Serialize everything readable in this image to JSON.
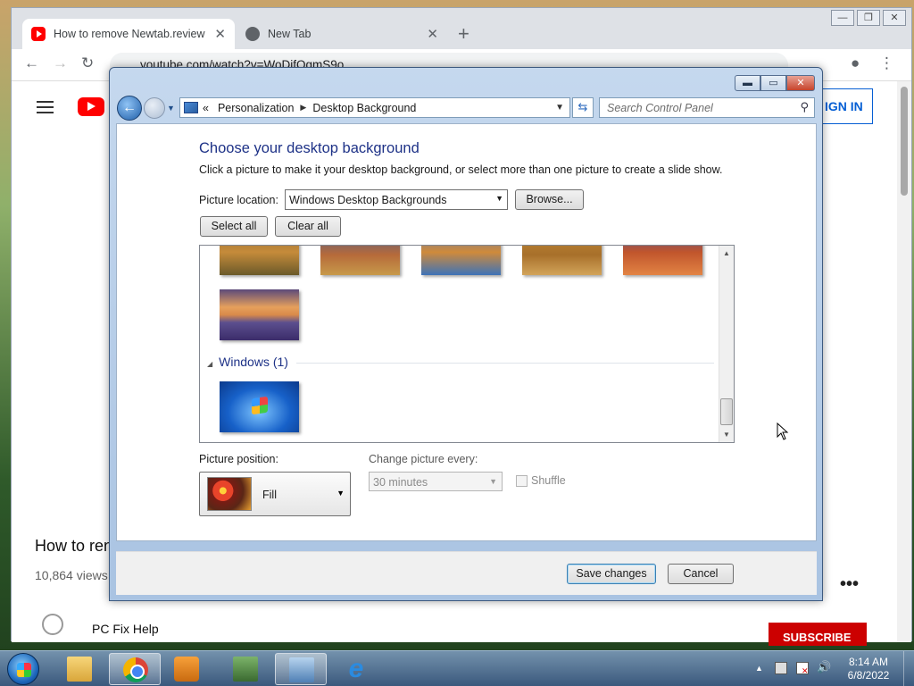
{
  "browser": {
    "tabs": [
      {
        "title": "How to remove Newtab.review (C",
        "favicon": "youtube-icon"
      },
      {
        "title": "New Tab",
        "favicon": "globe-icon"
      }
    ],
    "url": "youtube.com/watch?v=WoDifOgmS9o"
  },
  "youtube": {
    "sign_in": "IGN IN",
    "video_title": "How to ren",
    "views": "10,864 views",
    "more": "•••",
    "channel": "PC Fix Help",
    "subscribe": "SUBSCRIBE"
  },
  "control_panel": {
    "breadcrumb_prefix": "«",
    "breadcrumbs": [
      "Personalization",
      "Desktop Background"
    ],
    "search_placeholder": "Search Control Panel",
    "heading": "Choose your desktop background",
    "description": "Click a picture to make it your desktop background, or select more than one picture to create a slide show.",
    "picture_location_label": "Picture location:",
    "picture_location_value": "Windows Desktop Backgrounds",
    "browse": "Browse...",
    "select_all": "Select all",
    "clear_all": "Clear all",
    "group_label": "Windows (1)",
    "picture_position_label": "Picture position:",
    "picture_position_value": "Fill",
    "change_every_label": "Change picture every:",
    "change_every_value": "30 minutes",
    "shuffle_label": "Shuffle",
    "shuffle_checked": false,
    "save": "Save changes",
    "cancel": "Cancel"
  },
  "taskbar": {
    "apps": [
      "windows-explorer-icon",
      "chrome-icon",
      "media-player-icon",
      "control-panel-icon",
      "control-panel-window-icon",
      "internet-explorer-icon"
    ],
    "time": "8:14 AM",
    "date": "6/8/2022"
  }
}
